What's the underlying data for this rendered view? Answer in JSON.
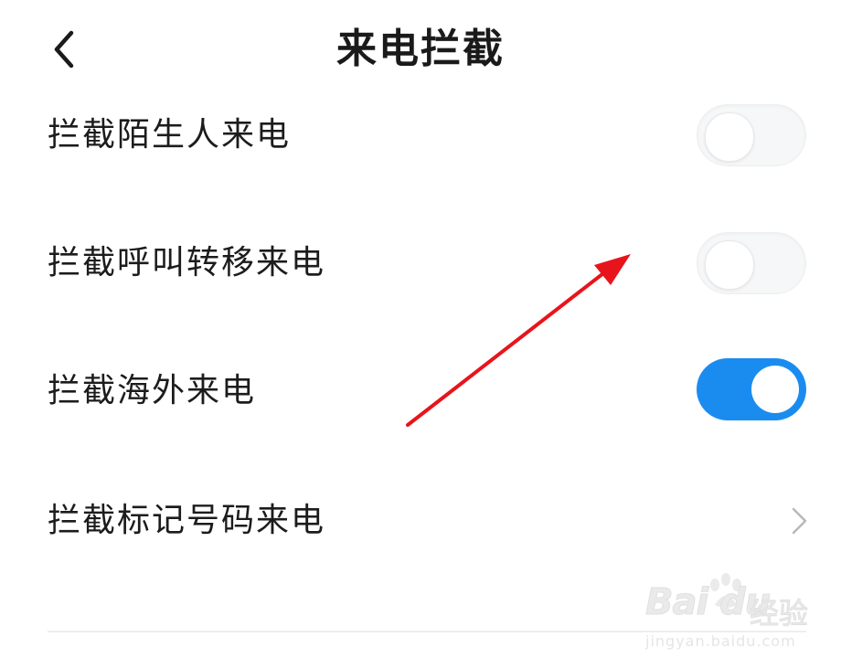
{
  "header": {
    "title": "来电拦截",
    "back_icon": "chevron-left-icon"
  },
  "settings": [
    {
      "label": "拦截陌生人来电",
      "control": "switch",
      "on": false
    },
    {
      "label": "拦截呼叫转移来电",
      "control": "switch",
      "on": false
    },
    {
      "label": "拦截海外来电",
      "control": "switch",
      "on": true
    },
    {
      "label": "拦截标记号码来电",
      "control": "chevron",
      "icon": "chevron-right-icon"
    }
  ],
  "colors": {
    "switch_on": "#1a8cf0",
    "switch_off": "#f6f7f8",
    "annotation_arrow": "#e8141c"
  },
  "watermark": {
    "brand": "Bai du",
    "service": "经验",
    "url": "jingyan.baidu.com"
  }
}
